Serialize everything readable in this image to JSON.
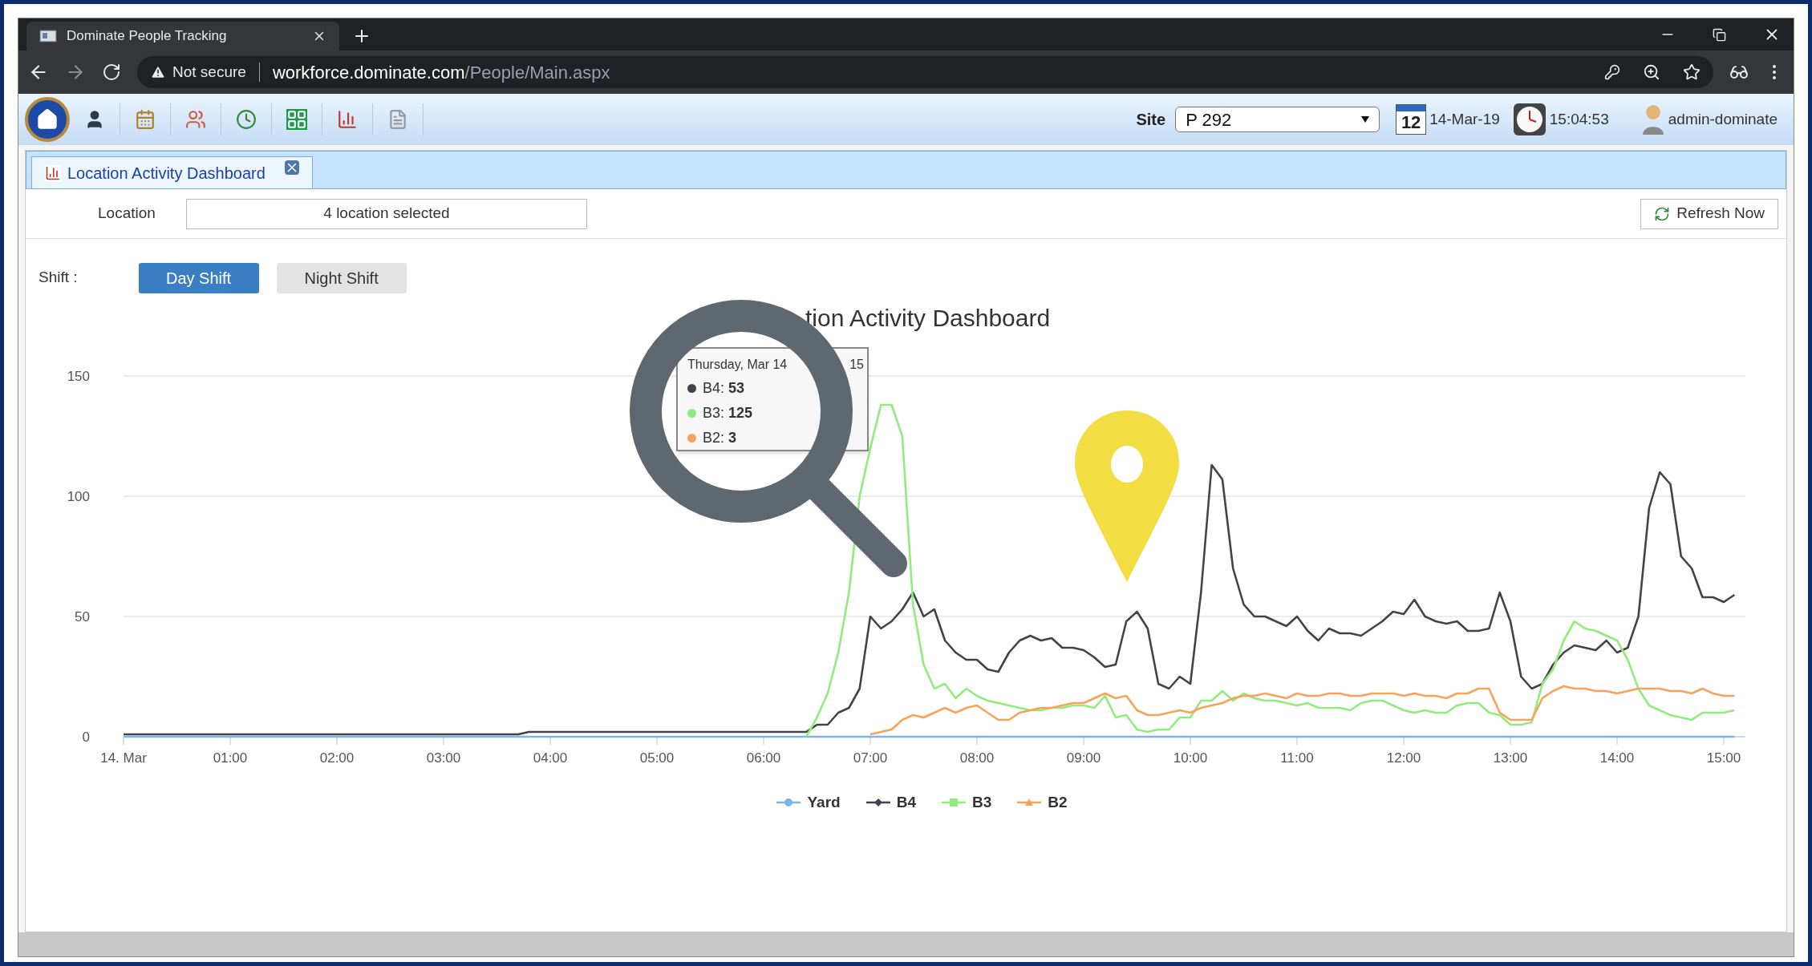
{
  "browser": {
    "tab_title": "Dominate People Tracking",
    "url_warning": "Not secure",
    "url_host": "workforce.dominate.com",
    "url_path": "/People/Main.aspx"
  },
  "toolbar": {
    "site_label": "Site",
    "site_value": "P 292",
    "calendar_day": "12",
    "date": "14-Mar-19",
    "time": "15:04:53",
    "user": "admin-dominate"
  },
  "tabs": [
    {
      "label": "Location Activity Dashboard",
      "selected": true
    }
  ],
  "filters": {
    "location_label": "Location",
    "location_value": "4 location selected",
    "refresh": "Refresh Now"
  },
  "shift": {
    "label": "Shift :",
    "options": [
      {
        "label": "Day Shift",
        "selected": true
      },
      {
        "label": "Night Shift",
        "selected": false
      }
    ]
  },
  "chart": {
    "title_visible": "tion Activity Dashboard",
    "tooltip": {
      "header_start": "Thursday, Mar 14",
      "header_end": "15",
      "rows": [
        {
          "label": "B4:",
          "value": "53",
          "color": "#434348"
        },
        {
          "label": "B3:",
          "value": "125",
          "color": "#90ed7d"
        },
        {
          "label": "B2:",
          "value": "3",
          "color": "#f7a35c"
        }
      ]
    },
    "series_markers": [
      {
        "kind": "circle"
      },
      {
        "kind": "diamond"
      },
      {
        "kind": "square"
      },
      {
        "kind": "triangle"
      }
    ],
    "chart_data": {
      "type": "line",
      "legend": "bottom",
      "xlim": [
        0,
        15.2
      ],
      "ylim": [
        0,
        150
      ],
      "yticks": [
        0,
        50,
        100,
        150
      ],
      "xticks": [
        {
          "value": 0,
          "label": "14. Mar"
        },
        {
          "value": 1,
          "label": "01:00"
        },
        {
          "value": 2,
          "label": "02:00"
        },
        {
          "value": 3,
          "label": "03:00"
        },
        {
          "value": 4,
          "label": "04:00"
        },
        {
          "value": 5,
          "label": "05:00"
        },
        {
          "value": 6,
          "label": "06:00"
        },
        {
          "value": 7,
          "label": "07:00"
        },
        {
          "value": 8,
          "label": "08:00"
        },
        {
          "value": 9,
          "label": "09:00"
        },
        {
          "value": 10,
          "label": "10:00"
        },
        {
          "value": 11,
          "label": "11:00"
        },
        {
          "value": 12,
          "label": "12:00"
        },
        {
          "value": 13,
          "label": "13:00"
        },
        {
          "value": 14,
          "label": "14:00"
        },
        {
          "value": 15,
          "label": "15:00"
        }
      ],
      "x": [
        0,
        3.7,
        3.8,
        6.3,
        6.4,
        6.5,
        6.6,
        6.7,
        6.8,
        6.9,
        7.0,
        7.1,
        7.2,
        7.3,
        7.4,
        7.5,
        7.6,
        7.7,
        7.8,
        7.9,
        8.0,
        8.1,
        8.2,
        8.3,
        8.4,
        8.5,
        8.6,
        8.7,
        8.8,
        8.9,
        9.0,
        9.1,
        9.2,
        9.3,
        9.4,
        9.5,
        9.6,
        9.7,
        9.8,
        9.9,
        10.0,
        10.1,
        10.2,
        10.3,
        10.4,
        10.5,
        10.6,
        10.7,
        10.8,
        10.9,
        11.0,
        11.1,
        11.2,
        11.3,
        11.4,
        11.5,
        11.6,
        11.7,
        11.8,
        11.9,
        12.0,
        12.1,
        12.2,
        12.3,
        12.4,
        12.5,
        12.6,
        12.7,
        12.8,
        12.9,
        13.0,
        13.1,
        13.2,
        13.3,
        13.4,
        13.5,
        13.6,
        13.7,
        13.8,
        13.9,
        14.0,
        14.1,
        14.2,
        14.3,
        14.4,
        14.5,
        14.6,
        14.7,
        14.8,
        14.9,
        15.0,
        15.1
      ],
      "series": [
        {
          "name": "Yard",
          "color": "#7cb5ec",
          "values": [
            0,
            0,
            0,
            0,
            0,
            0,
            0,
            0,
            0,
            0,
            0,
            0,
            0,
            0,
            0,
            0,
            0,
            0,
            0,
            0,
            0,
            0,
            0,
            0,
            0,
            0,
            0,
            0,
            0,
            0,
            0,
            0,
            0,
            0,
            0,
            0,
            0,
            0,
            0,
            0,
            0,
            0,
            0,
            0,
            0,
            0,
            0,
            0,
            0,
            0,
            0,
            0,
            0,
            0,
            0,
            0,
            0,
            0,
            0,
            0,
            0,
            0,
            0,
            0,
            0,
            0,
            0,
            0,
            0,
            0,
            0,
            0,
            0,
            0,
            0,
            0,
            0,
            0,
            0,
            0,
            0,
            0,
            0,
            0,
            0,
            0,
            0,
            0,
            0,
            0,
            0,
            0
          ]
        },
        {
          "name": "B4",
          "color": "#434348",
          "values": [
            1,
            1,
            2,
            2,
            2,
            5,
            5,
            10,
            12,
            20,
            50,
            45,
            48,
            53,
            60,
            50,
            53,
            40,
            35,
            32,
            32,
            28,
            27,
            35,
            40,
            42,
            40,
            41,
            37,
            37,
            36,
            33,
            29,
            30,
            48,
            52,
            45,
            22,
            20,
            25,
            22,
            60,
            113,
            107,
            70,
            55,
            50,
            50,
            48,
            46,
            50,
            44,
            40,
            45,
            43,
            43,
            42,
            45,
            48,
            52,
            51,
            57,
            50,
            48,
            47,
            48,
            44,
            44,
            45,
            60,
            48,
            25,
            20,
            22,
            30,
            35,
            38,
            37,
            36,
            40,
            35,
            37,
            50,
            95,
            110,
            105,
            75,
            70,
            58,
            58,
            56,
            59
          ]
        },
        {
          "name": "B3",
          "color": "#90ed7d",
          "values": [
            null,
            null,
            null,
            null,
            0,
            8,
            18,
            35,
            60,
            100,
            120,
            138,
            138,
            125,
            55,
            30,
            20,
            22,
            16,
            20,
            17,
            15,
            14,
            13,
            12,
            11,
            11,
            12,
            12,
            13,
            13,
            12,
            17,
            8,
            9,
            3,
            2,
            3,
            3,
            8,
            8,
            15,
            15,
            19,
            15,
            18,
            16,
            15,
            15,
            14,
            13,
            14,
            12,
            12,
            12,
            11,
            14,
            15,
            15,
            13,
            11,
            10,
            11,
            10,
            10,
            13,
            14,
            14,
            10,
            9,
            5,
            5,
            6,
            22,
            28,
            40,
            48,
            45,
            44,
            42,
            40,
            32,
            20,
            13,
            11,
            9,
            8,
            7,
            10,
            10,
            10,
            11
          ]
        },
        {
          "name": "B2",
          "color": "#f7a35c",
          "values": [
            null,
            null,
            null,
            null,
            null,
            null,
            null,
            null,
            null,
            null,
            1,
            2,
            3,
            7,
            9,
            8,
            10,
            12,
            10,
            12,
            13,
            10,
            7,
            7,
            10,
            11,
            12,
            12,
            13,
            14,
            14,
            16,
            18,
            16,
            17,
            11,
            9,
            9,
            10,
            11,
            10,
            12,
            13,
            14,
            16,
            17,
            17,
            18,
            17,
            16,
            18,
            17,
            17,
            18,
            18,
            17,
            17,
            18,
            18,
            18,
            17,
            18,
            17,
            17,
            16,
            18,
            18,
            20,
            20,
            10,
            7,
            7,
            7,
            16,
            19,
            21,
            20,
            20,
            19,
            19,
            18,
            19,
            20,
            20,
            20,
            19,
            19,
            18,
            20,
            18,
            17,
            17
          ]
        }
      ]
    }
  }
}
